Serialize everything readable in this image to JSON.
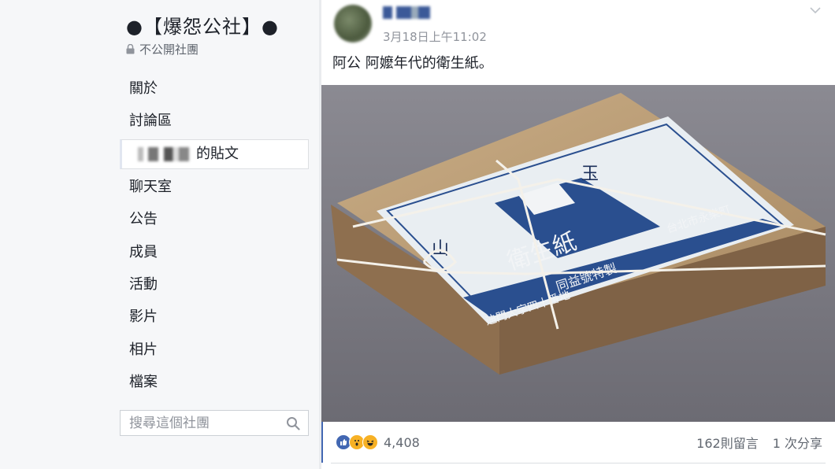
{
  "group": {
    "title": "●【爆怨公社】●",
    "privacy": "不公開社團"
  },
  "nav": {
    "items": [
      {
        "label": "關於"
      },
      {
        "label": "討論區"
      },
      {
        "label": "的貼文"
      },
      {
        "label": "聊天室"
      },
      {
        "label": "公告"
      },
      {
        "label": "成員"
      },
      {
        "label": "活動"
      },
      {
        "label": "影片"
      },
      {
        "label": "相片"
      },
      {
        "label": "檔案"
      }
    ]
  },
  "search": {
    "placeholder": "搜尋這個社團"
  },
  "post": {
    "timestamp": "3月18日上午11:02",
    "text": "阿公 阿嬤年代的衛生紙。",
    "photo_label": {
      "top_char": "玉",
      "left_char": "山",
      "main_text": "衛生紙",
      "sub_text": "同益號特製",
      "side_text": "台北市永樂町",
      "bottom_text": "迪門大字四十番地"
    },
    "reactions": {
      "icons": [
        "like-icon",
        "wow-icon",
        "haha-icon"
      ],
      "count": "4,408"
    },
    "comments": "162則留言",
    "shares": "1 次分享"
  },
  "colors": {
    "accent": "#4267b2",
    "sidebar_bg": "#f6f7f9",
    "secondary_text": "#616770",
    "stamp_blue": "#2a4f8f"
  }
}
